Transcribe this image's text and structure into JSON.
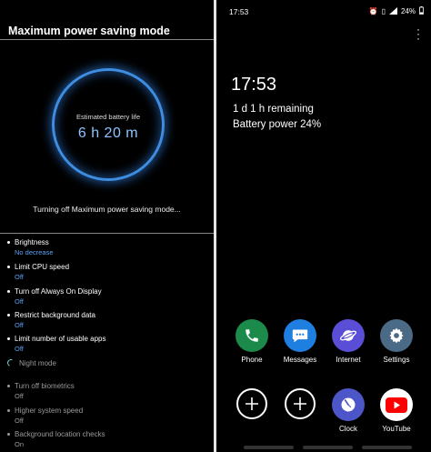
{
  "left": {
    "title": "Maximum power saving mode",
    "estimate_label": "Estimated battery life",
    "estimate_value": "6 h 20 m",
    "turning_off_text": "Turning off Maximum power saving mode...",
    "options": [
      {
        "name": "Brightness",
        "status": "No decrease"
      },
      {
        "name": "Limit CPU speed",
        "status": "Off"
      },
      {
        "name": "Turn off Always On Display",
        "status": "Off"
      },
      {
        "name": "Restrict background data",
        "status": "Off"
      },
      {
        "name": "Limit number of usable apps",
        "status": "Off"
      },
      {
        "name": "Night mode",
        "status": ""
      },
      {
        "name": "Turn off biometrics",
        "status": "Off"
      },
      {
        "name": "Higher system speed",
        "status": "Off"
      },
      {
        "name": "Background location checks",
        "status": "On"
      }
    ]
  },
  "right": {
    "status_bar": {
      "time": "17:53",
      "battery_pct": "24%"
    },
    "clock": "17:53",
    "remaining": "1 d 1 h remaining",
    "battery_power": "Battery power 24%",
    "apps_row1": [
      {
        "label": "Phone",
        "icon": "phone-icon"
      },
      {
        "label": "Messages",
        "icon": "messages-icon"
      },
      {
        "label": "Internet",
        "icon": "internet-icon"
      },
      {
        "label": "Settings",
        "icon": "settings-icon"
      }
    ],
    "apps_row2": [
      {
        "label": "",
        "icon": "add-app-icon"
      },
      {
        "label": "",
        "icon": "add-app-icon"
      },
      {
        "label": "Clock",
        "icon": "clock-icon"
      },
      {
        "label": "YouTube",
        "icon": "youtube-icon"
      }
    ]
  },
  "colors": {
    "ring": "#3e8de0",
    "estimate_text": "#8ec4ff",
    "status_blue": "#5aa0f0",
    "dim_text": "#9a9a9a"
  }
}
